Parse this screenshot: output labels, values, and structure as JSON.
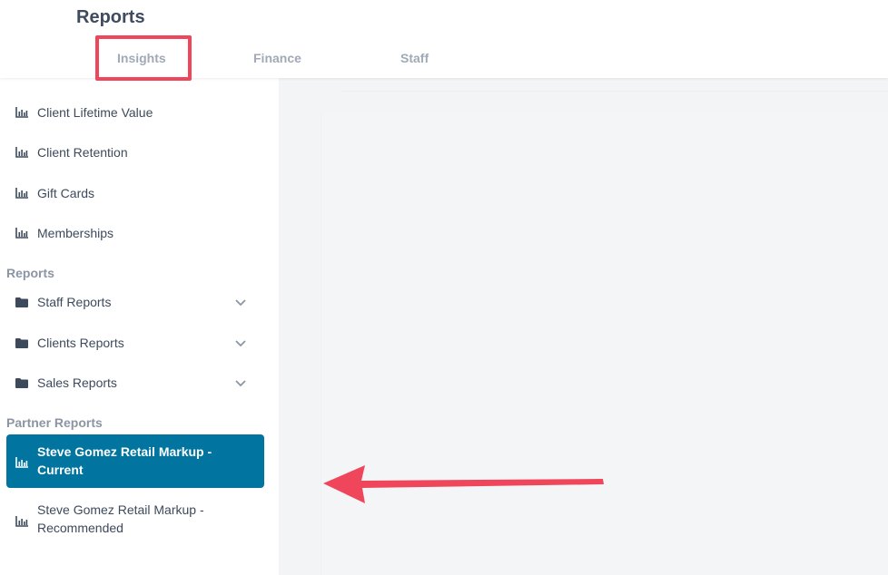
{
  "header": {
    "title": "Reports",
    "tabs": [
      {
        "label": "Insights"
      },
      {
        "label": "Finance"
      },
      {
        "label": "Staff"
      }
    ]
  },
  "sidebar": {
    "insights": [
      {
        "label": "Client Lifetime Value",
        "icon": "bar-chart-icon"
      },
      {
        "label": "Client Retention",
        "icon": "bar-chart-icon"
      },
      {
        "label": "Gift Cards",
        "icon": "bar-chart-icon"
      },
      {
        "label": "Memberships",
        "icon": "bar-chart-icon"
      }
    ],
    "reports_title": "Reports",
    "reports": [
      {
        "label": "Staff Reports",
        "icon": "folder-icon"
      },
      {
        "label": "Clients Reports",
        "icon": "folder-icon"
      },
      {
        "label": "Sales Reports",
        "icon": "folder-icon"
      }
    ],
    "partner_title": "Partner Reports",
    "partner": [
      {
        "label": "Steve Gomez Retail Markup - Current",
        "icon": "bar-chart-icon",
        "active": true
      },
      {
        "label": "Steve Gomez Retail Markup - Recommended",
        "icon": "bar-chart-icon",
        "active": false
      }
    ]
  },
  "colors": {
    "accent": "#01759f",
    "annotation": "#f0465b"
  }
}
